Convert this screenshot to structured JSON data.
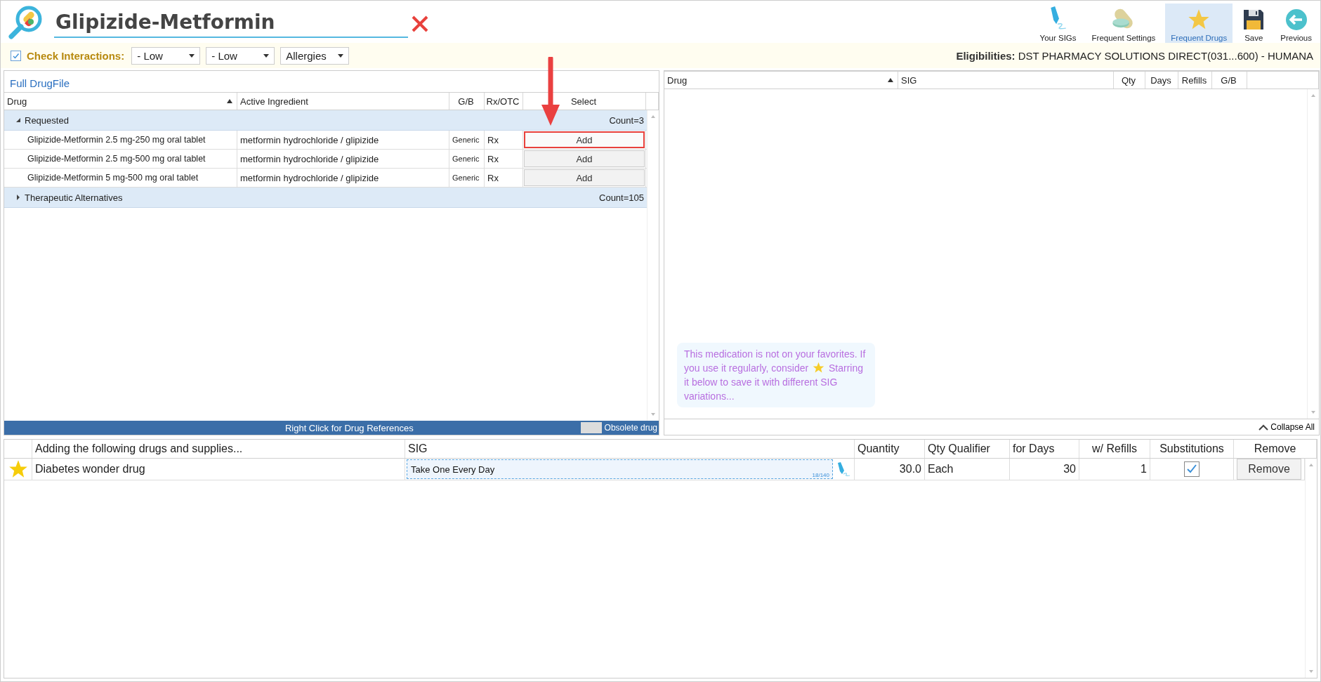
{
  "header": {
    "search_value": "Glipizide-Metformin"
  },
  "toolbar": [
    {
      "label": "Your SIGs",
      "kind": "pen",
      "selected": false
    },
    {
      "label": "Frequent Settings",
      "kind": "pill",
      "selected": false
    },
    {
      "label": "Frequent Drugs",
      "kind": "star",
      "selected": true
    },
    {
      "label": "Save",
      "kind": "save",
      "selected": false
    },
    {
      "label": "Previous",
      "kind": "back",
      "selected": false
    }
  ],
  "interactions": {
    "label": "Check Interactions:",
    "checked": true,
    "dropdowns": [
      "- Low",
      "- Low",
      "Allergies"
    ]
  },
  "eligibilities": {
    "label": "Eligibilities:",
    "value": "DST PHARMACY SOLUTIONS DIRECT(031...600) - HUMANA"
  },
  "drug_file": {
    "title": "Full DrugFile",
    "columns": [
      {
        "label": "Drug",
        "sorted": true
      },
      {
        "label": "Active Ingredient",
        "sorted": false
      },
      {
        "label": "G/B",
        "sorted": false
      },
      {
        "label": "Rx/OTC",
        "sorted": false
      },
      {
        "label": "Select",
        "sorted": false
      }
    ],
    "groups": [
      {
        "name": "Requested",
        "count": "Count=3",
        "expanded": true,
        "rows": [
          {
            "drug": "Glipizide-Metformin 2.5 mg-250 mg oral tablet",
            "ingredient": "metformin hydrochloride / glipizide",
            "gb": "Generic",
            "rx": "Rx",
            "action": "Add",
            "highlighted": true
          },
          {
            "drug": "Glipizide-Metformin 2.5 mg-500 mg oral tablet",
            "ingredient": "metformin hydrochloride / glipizide",
            "gb": "Generic",
            "rx": "Rx",
            "action": "Add",
            "highlighted": false
          },
          {
            "drug": "Glipizide-Metformin 5 mg-500 mg oral tablet",
            "ingredient": "metformin hydrochloride / glipizide",
            "gb": "Generic",
            "rx": "Rx",
            "action": "Add",
            "highlighted": false
          }
        ]
      },
      {
        "name": "Therapeutic Alternatives",
        "count": "Count=105",
        "expanded": false
      }
    ],
    "footer": "Right Click for Drug References",
    "legend": "Obsolete drug"
  },
  "selection": {
    "columns": [
      {
        "label": "Drug",
        "sorted": true
      },
      {
        "label": "SIG",
        "sorted": false
      },
      {
        "label": "Qty",
        "sorted": false
      },
      {
        "label": "Days",
        "sorted": false
      },
      {
        "label": "Refills",
        "sorted": false
      },
      {
        "label": "G/B",
        "sorted": false
      }
    ],
    "hint_before": "This medication is not on your favorites. If you use it regularly, consider",
    "hint_after": "Starring it below to save it with different SIG variations...",
    "collapse": "Collapse All"
  },
  "adding": {
    "columns": [
      "Adding the following drugs and supplies...",
      "SIG",
      "Quantity",
      "Qty Qualifier",
      "for Days",
      "w/ Refills",
      "Substitutions",
      "Remove"
    ],
    "rows": [
      {
        "starred": true,
        "name": "Diabetes wonder drug",
        "sig": "Take One Every Day",
        "sig_count": "18/140",
        "quantity": "30.0",
        "qualifier": "Each",
        "days": "30",
        "refills": "1",
        "substitutions": true,
        "remove": "Remove"
      }
    ]
  }
}
